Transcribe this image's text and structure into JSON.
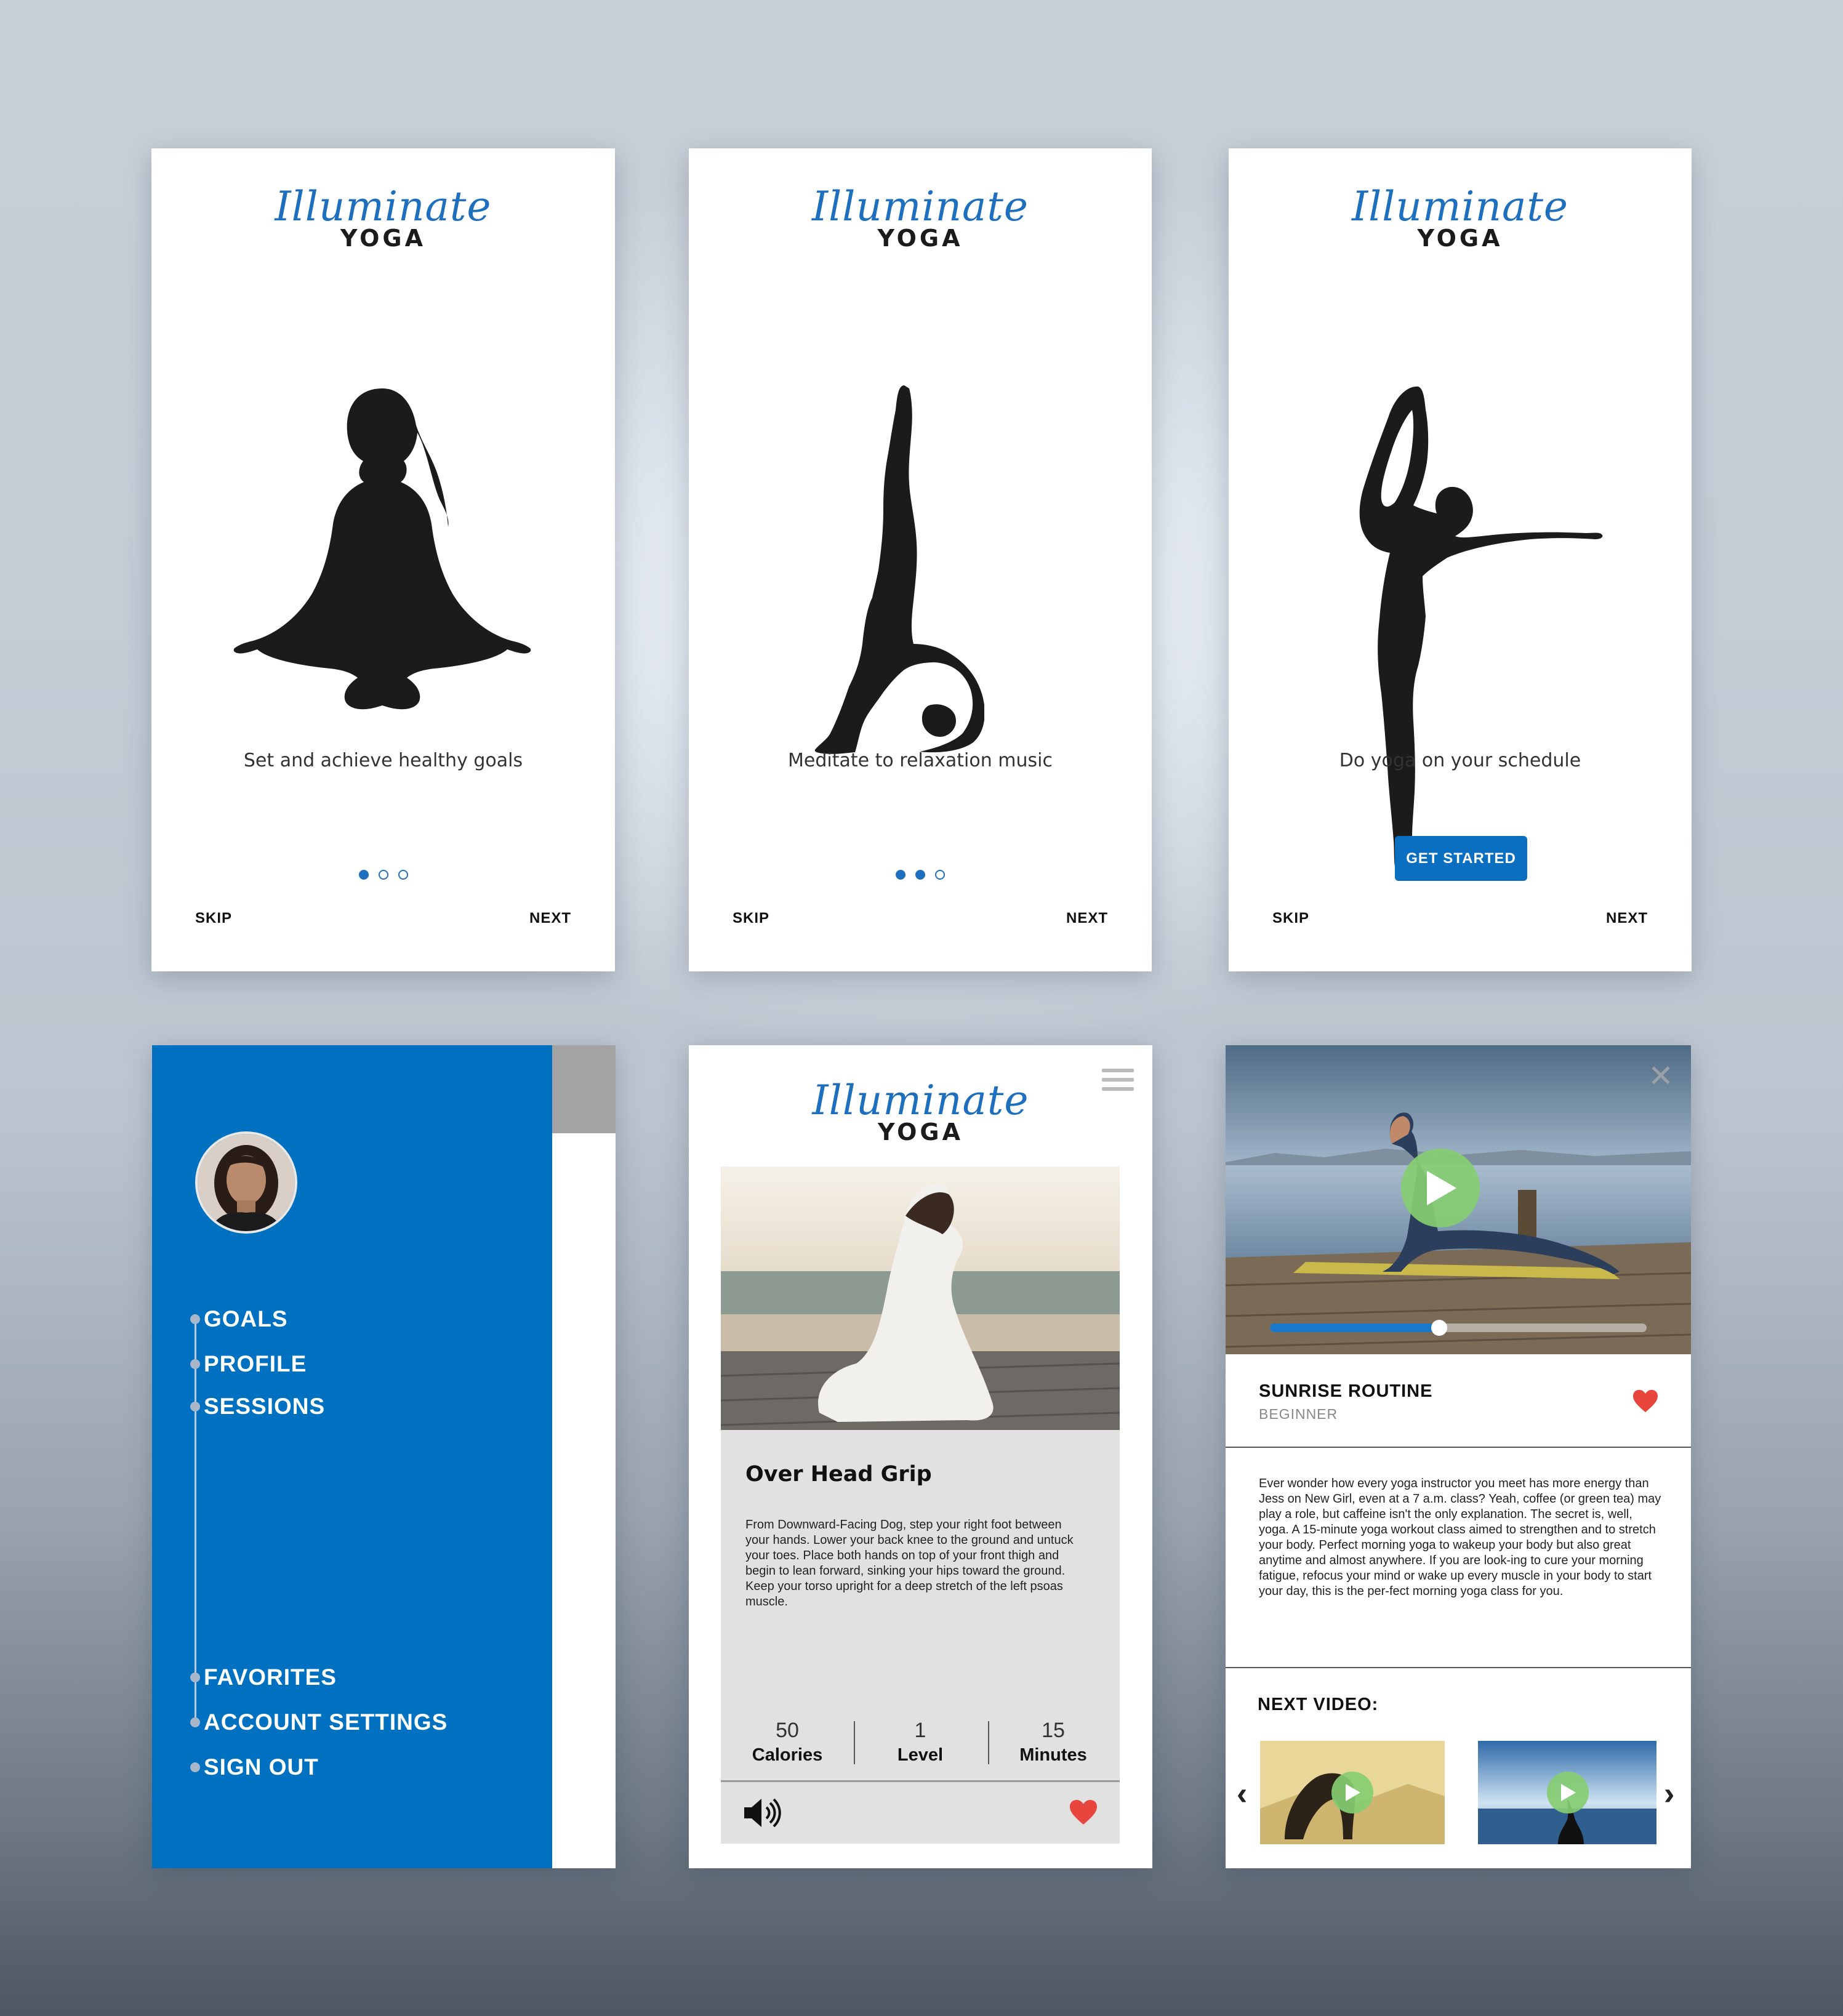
{
  "brand": {
    "script": "Illuminate",
    "word": "YOGA",
    "color": "#1f6fbf"
  },
  "onboarding": [
    {
      "caption": "Set and achieve healthy goals",
      "dots": [
        true,
        false,
        false
      ],
      "skip": "SKIP",
      "next": "NEXT",
      "illustration": "lotus-pose-silhouette"
    },
    {
      "caption": "Meditate to relaxation music",
      "dots": [
        true,
        true,
        false
      ],
      "skip": "SKIP",
      "next": "NEXT",
      "illustration": "scorpion-pose-silhouette"
    },
    {
      "caption": "Do yoga on your schedule",
      "button": "GET STARTED",
      "skip": "SKIP",
      "next": "NEXT",
      "illustration": "dancer-pose-silhouette"
    }
  ],
  "menu": {
    "items_top": [
      "GOALS",
      "PROFILE",
      "SESSIONS"
    ],
    "items_bottom": [
      "FAVORITES",
      "ACCOUNT SETTINGS",
      "SIGN OUT"
    ],
    "panel_color": "#0070c0"
  },
  "pose": {
    "title": "Over Head Grip",
    "description": "From Downward-Facing Dog, step your right foot between your hands. Lower your back knee to the ground and untuck your toes. Place both hands on top of your front thigh and begin to lean forward, sinking your hips toward the ground. Keep your torso upright for a deep stretch of the left psoas muscle.",
    "stats": [
      {
        "value": "50",
        "label": "Calories"
      },
      {
        "value": "1",
        "label": "Level"
      },
      {
        "value": "15",
        "label": "Minutes"
      }
    ],
    "icons": [
      "menu-icon",
      "speaker-icon",
      "heart-icon"
    ]
  },
  "video": {
    "title": "SUNRISE ROUTINE",
    "level": "BEGINNER",
    "progress": 0.45,
    "description": "Ever wonder how every yoga instructor you meet has more energy than Jess on New Girl, even at a 7 a.m. class? Yeah, coffee (or green tea) may play a role, but caffeine isn't the only explanation. The secret is, well, yoga. A 15-minute yoga workout class aimed to strengthen and to stretch your body. Perfect morning yoga to wakeup your body but also great anytime and almost anywhere. If you are look-ing to cure your morning fatigue, refocus your mind or wake up every muscle in your body to start your day, this is the per-fect morning yoga class for you.",
    "next_label": "NEXT VIDEO:",
    "icons": [
      "close-icon",
      "play-icon",
      "heart-icon",
      "chevron-left-icon",
      "chevron-right-icon"
    ]
  }
}
